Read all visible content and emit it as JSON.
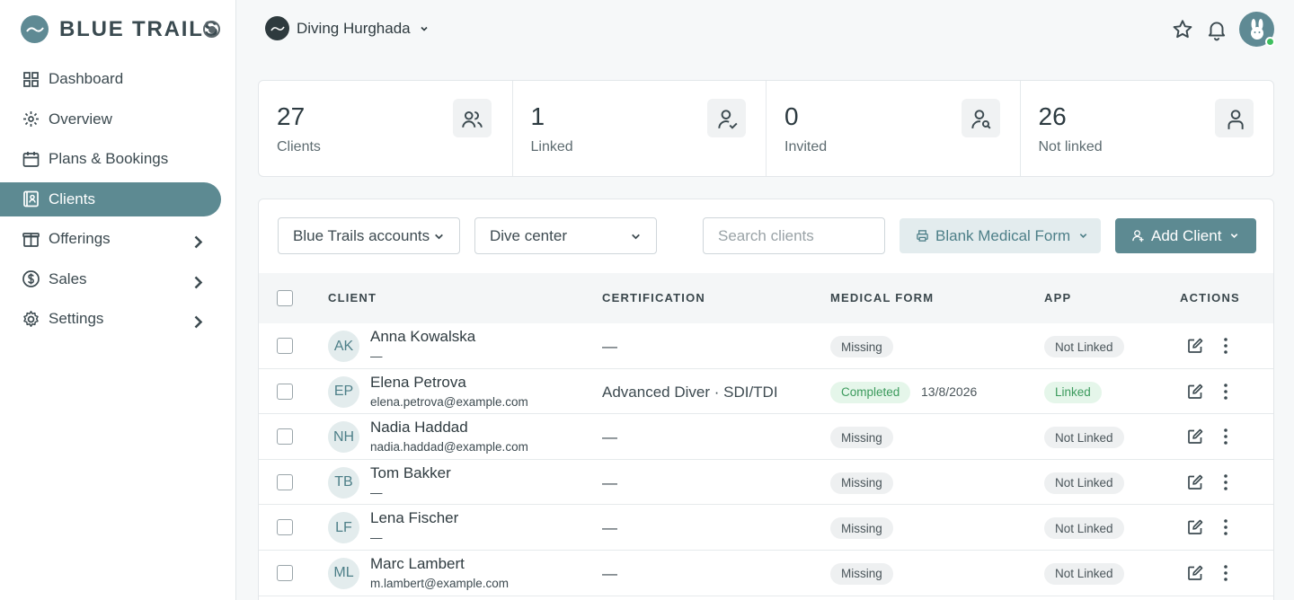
{
  "brand": {
    "name": "BLUE TRAILS"
  },
  "nav": [
    {
      "label": "Dashboard",
      "icon": "dashboard-icon",
      "active": false,
      "chevron": false
    },
    {
      "label": "Overview",
      "icon": "overview-icon",
      "active": false,
      "chevron": false
    },
    {
      "label": "Plans & Bookings",
      "icon": "calendar-icon",
      "active": false,
      "chevron": false
    },
    {
      "label": "Clients",
      "icon": "clients-icon",
      "active": true,
      "chevron": false
    },
    {
      "label": "Offerings",
      "icon": "offerings-icon",
      "active": false,
      "chevron": true
    },
    {
      "label": "Sales",
      "icon": "dollar-icon",
      "active": false,
      "chevron": true
    },
    {
      "label": "Settings",
      "icon": "gear-icon",
      "active": false,
      "chevron": true
    }
  ],
  "topbar": {
    "org_name": "Diving Hurghada"
  },
  "stats": [
    {
      "value": "27",
      "label": "Clients",
      "icon": "users-icon"
    },
    {
      "value": "1",
      "label": "Linked",
      "icon": "user-check-icon"
    },
    {
      "value": "0",
      "label": "Invited",
      "icon": "user-search-icon"
    },
    {
      "value": "26",
      "label": "Not linked",
      "icon": "user-icon"
    }
  ],
  "filters": {
    "account_select": "Blue Trails accounts",
    "dive_center_select": "Dive center",
    "search_placeholder": "Search clients",
    "medical_button": "Blank Medical Form",
    "add_button": "Add Client"
  },
  "table": {
    "headers": {
      "client": "CLIENT",
      "certification": "CERTIFICATION",
      "medical": "MEDICAL FORM",
      "app": "APP",
      "actions": "ACTIONS"
    },
    "rows": [
      {
        "initials": "AK",
        "name": "Anna Kowalska",
        "email": "—",
        "certification": "—",
        "medical": "Missing",
        "medical_status": "missing",
        "medical_date": "",
        "app": "Not Linked",
        "app_status": "notlinked"
      },
      {
        "initials": "EP",
        "name": "Elena Petrova",
        "email": "elena.petrova@example.com",
        "certification": "Advanced Diver · SDI/TDI",
        "medical": "Completed",
        "medical_status": "completed",
        "medical_date": "13/8/2026",
        "app": "Linked",
        "app_status": "linked"
      },
      {
        "initials": "NH",
        "name": "Nadia Haddad",
        "email": "nadia.haddad@example.com",
        "certification": "—",
        "medical": "Missing",
        "medical_status": "missing",
        "medical_date": "",
        "app": "Not Linked",
        "app_status": "notlinked"
      },
      {
        "initials": "TB",
        "name": "Tom Bakker",
        "email": "—",
        "certification": "—",
        "medical": "Missing",
        "medical_status": "missing",
        "medical_date": "",
        "app": "Not Linked",
        "app_status": "notlinked"
      },
      {
        "initials": "LF",
        "name": "Lena Fischer",
        "email": "—",
        "certification": "—",
        "medical": "Missing",
        "medical_status": "missing",
        "medical_date": "",
        "app": "Not Linked",
        "app_status": "notlinked"
      },
      {
        "initials": "ML",
        "name": "Marc Lambert",
        "email": "m.lambert@example.com",
        "certification": "—",
        "medical": "Missing",
        "medical_status": "missing",
        "medical_date": "",
        "app": "Not Linked",
        "app_status": "notlinked"
      }
    ]
  },
  "colors": {
    "accent": "#5d8a92",
    "accent_light": "#e3ecee",
    "success": "#3b9a5c",
    "online": "#3fbf5f"
  }
}
